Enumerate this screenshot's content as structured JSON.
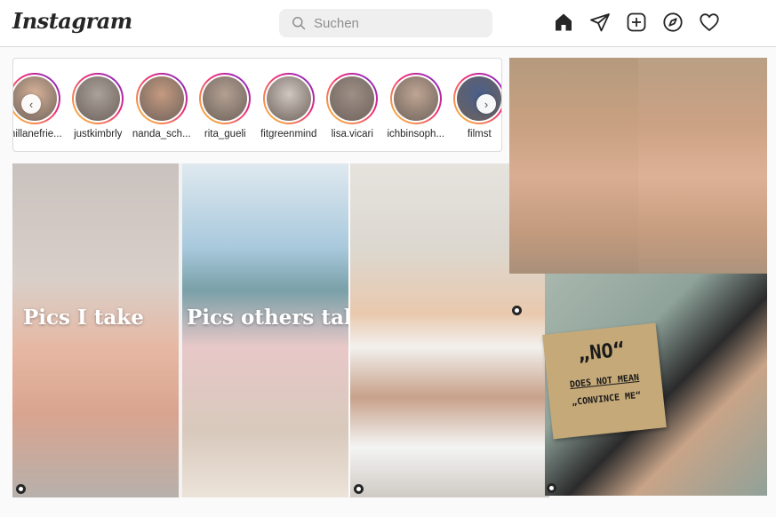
{
  "app": {
    "logo": "Instagram"
  },
  "search": {
    "placeholder": "Suchen"
  },
  "nav": {
    "icons": [
      "home-icon",
      "direct-send-icon",
      "new-post-icon",
      "explore-compass-icon",
      "activity-heart-icon"
    ]
  },
  "stories": {
    "items": [
      {
        "name": "millanefrie..."
      },
      {
        "name": "justkimbrly"
      },
      {
        "name": "nanda_sch..."
      },
      {
        "name": "rita_gueli"
      },
      {
        "name": "fitgreenmind"
      },
      {
        "name": "lisa.vicari"
      },
      {
        "name": "ichbinsoph..."
      },
      {
        "name": "filmst"
      }
    ],
    "prev_icon": "chevron-left-icon",
    "next_icon": "chevron-right-icon"
  },
  "posts": {
    "post1": {
      "caption_left": "Pics I take",
      "caption_right": "Pics others take"
    },
    "post3": {
      "sign_line1": "„NO“",
      "sign_line2": "DOES NOT MEAN",
      "sign_line3": "„CONVINCE ME“"
    }
  },
  "colors": {
    "story_ring_start": "#f9ce34",
    "story_ring_mid": "#ee2a7b",
    "story_ring_end": "#6228d7",
    "search_bg": "#efefef"
  }
}
